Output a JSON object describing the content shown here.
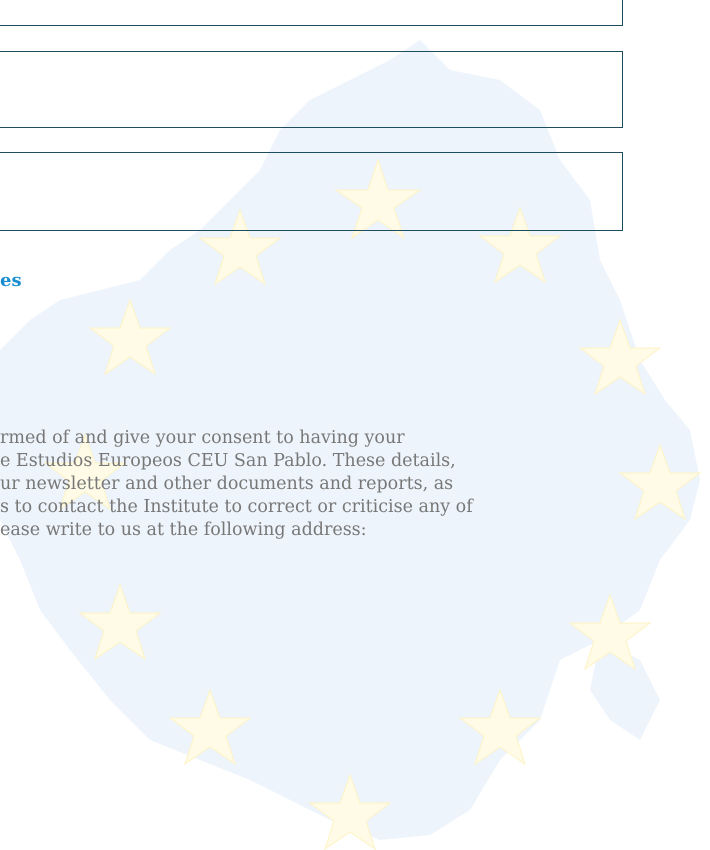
{
  "form": {
    "fields": [
      {
        "value": ""
      },
      {
        "value": ""
      },
      {
        "value": ""
      }
    ]
  },
  "section": {
    "heading_fragment": "es"
  },
  "consent": {
    "lines": [
      "rmed of and give your consent to having your",
      "e Estudios Europeos CEU San Pablo. These details,",
      "ur newsletter and other documents and reports, as",
      "s to contact the Institute to correct or criticise any of",
      "ease write to us at the following address:"
    ]
  },
  "background": {
    "map_color": "#eef4fb",
    "star_color": "#fffbe6"
  }
}
